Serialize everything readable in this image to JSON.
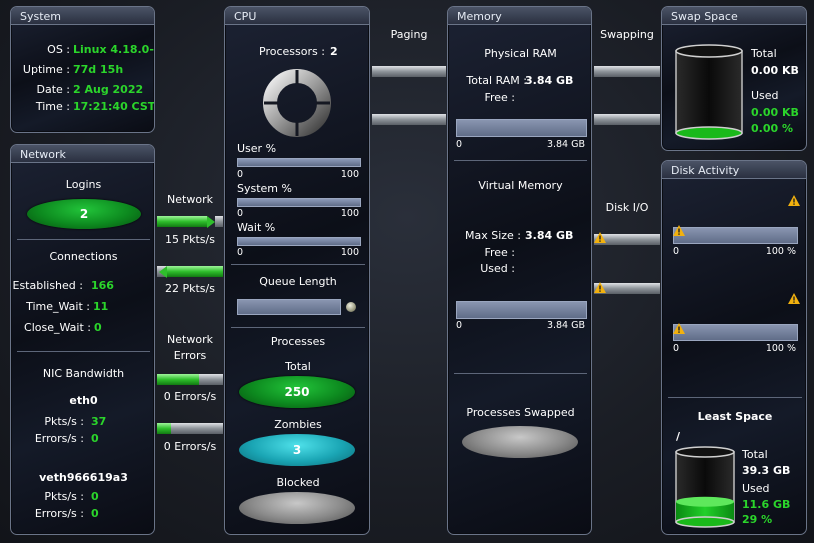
{
  "system": {
    "title": "System",
    "rows": [
      {
        "label": "OS :",
        "value": "Linux 4.18.0-..."
      },
      {
        "label": "Uptime :",
        "value": "77d 15h"
      },
      {
        "label": "Date :",
        "value": "2 Aug 2022"
      },
      {
        "label": "Time :",
        "value": "17:21:40 CST"
      }
    ]
  },
  "network": {
    "title": "Network",
    "logins_label": "Logins",
    "logins_value": "2",
    "connections_label": "Connections",
    "established_label": "Established :",
    "established_value": "166",
    "timewait_label": "Time_Wait :",
    "timewait_value": "11",
    "closewait_label": "Close_Wait :",
    "closewait_value": "0",
    "nic_label": "NIC Bandwidth",
    "nics": [
      {
        "name": "eth0",
        "pkts_label": "Pkts/s :",
        "pkts": "37",
        "errors_label": "Errors/s :",
        "errors": "0"
      },
      {
        "name": "veth966619a3",
        "pkts_label": "Pkts/s :",
        "pkts": "0",
        "errors_label": "Errors/s :",
        "errors": "0"
      }
    ]
  },
  "flows": {
    "network_label": "Network",
    "network_in": "15 Pkts/s",
    "network_out": "22 Pkts/s",
    "errors_label_1": "Network",
    "errors_label_2": "Errors",
    "errors_in": "0 Errors/s",
    "errors_out": "0 Errors/s",
    "paging_label": "Paging",
    "swapping_label": "Swapping",
    "diskio_label": "Disk I/O"
  },
  "cpu": {
    "title": "CPU",
    "processors_label": "Processors :",
    "processors_value": "2",
    "user_label": "User %",
    "system_label": "System %",
    "wait_label": "Wait %",
    "bar_min": "0",
    "bar_max": "100",
    "queue_label": "Queue Length",
    "processes_label": "Processes",
    "total_label": "Total",
    "total_value": "250",
    "zombies_label": "Zombies",
    "zombies_value": "3",
    "blocked_label": "Blocked",
    "blocked_value": ""
  },
  "memory": {
    "title": "Memory",
    "physical_label": "Physical RAM",
    "total_ram_label": "Total RAM :",
    "total_ram_value": "3.84 GB",
    "free_label": "Free :",
    "free_value": "",
    "scale_min": "0",
    "scale_max": "3.84 GB",
    "virtual_label": "Virtual Memory",
    "max_size_label": "Max Size :",
    "max_size_value": "3.84 GB",
    "vfree_label": "Free :",
    "vused_label": "Used :",
    "vscale_min": "0",
    "vscale_max": "3.84 GB",
    "swapped_label": "Processes Swapped"
  },
  "swap": {
    "title": "Swap Space",
    "total_label": "Total",
    "total_value": "0.00 KB",
    "used_label": "Used",
    "used_value": "0.00 KB",
    "used_pct": "0.00 %"
  },
  "disk": {
    "title": "Disk Activity",
    "scale_min": "0",
    "scale_max": "100 %",
    "least_space_label": "Least Space",
    "mount": "/",
    "total_label": "Total",
    "total_value": "39.3 GB",
    "used_label": "Used",
    "used_value": "11.6 GB",
    "used_pct": "29 %",
    "used_fraction": 0.29
  },
  "colors": {
    "accent_green": "#2bd52b",
    "warning": "#f2b10e"
  }
}
